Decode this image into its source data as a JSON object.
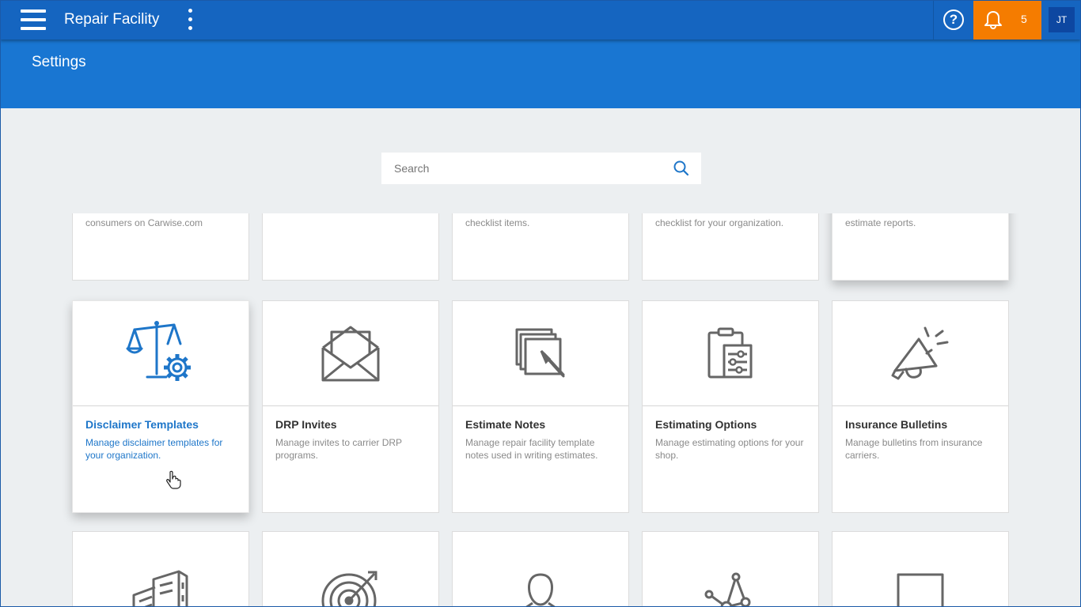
{
  "app": {
    "title": "Repair Facility"
  },
  "header": {
    "help_label": "?",
    "notification_count": "5",
    "avatar_initials": "JT"
  },
  "page": {
    "title": "Settings"
  },
  "search": {
    "placeholder": "Search"
  },
  "top_row": [
    {
      "desc": "consumers on Carwise.com"
    },
    {
      "desc": ""
    },
    {
      "desc": "checklist items."
    },
    {
      "desc": "checklist for your organization."
    },
    {
      "desc": "estimate reports."
    }
  ],
  "cards": [
    {
      "title": "Disclaimer Templates",
      "desc": "Manage disclaimer templates for your organization.",
      "icon": "scales-gear-icon",
      "active": true
    },
    {
      "title": "DRP Invites",
      "desc": "Manage invites to carrier DRP programs.",
      "icon": "envelope-icon"
    },
    {
      "title": "Estimate Notes",
      "desc": "Manage repair facility template notes used in writing estimates.",
      "icon": "notes-pencil-icon"
    },
    {
      "title": "Estimating Options",
      "desc": "Manage estimating options for your shop.",
      "icon": "clipboard-sliders-icon"
    },
    {
      "title": "Insurance Bulletins",
      "desc": "Manage bulletins from insurance carriers.",
      "icon": "megaphone-icon"
    }
  ],
  "bottom_row": [
    {
      "icon": "building-icon"
    },
    {
      "icon": "target-icon"
    },
    {
      "icon": "person-icon"
    },
    {
      "icon": "network-icon"
    },
    {
      "icon": "document-icon"
    }
  ]
}
